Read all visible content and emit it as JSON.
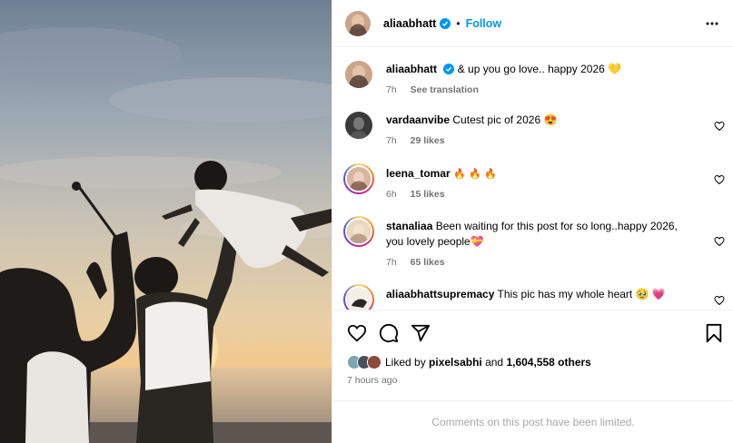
{
  "post_image": {
    "alt": ""
  },
  "header": {
    "username": "aliaabhatt",
    "separator": "•",
    "follow_label": "Follow",
    "more_icon": "more-horizontal-icon",
    "verified_color": "#0095f6"
  },
  "caption": {
    "username": "aliaabhatt",
    "text": "& up you go love.. happy 2026 💛",
    "time": "7h",
    "translate_label": "See translation"
  },
  "comments": [
    {
      "username": "vardaanvibe",
      "text": "Cutest pic of 2026 😍",
      "time": "7h",
      "likes": "29 likes"
    },
    {
      "username": "leena_tomar",
      "text": "🔥 🔥 🔥",
      "time": "6h",
      "likes": "15 likes"
    },
    {
      "username": "stanaliaa",
      "text": "Been waiting for this post for so long..happy 2026, you lovely people💝",
      "time": "7h",
      "likes": "65 likes"
    },
    {
      "username": "aliaabhattsupremacy",
      "text": "This pic has my whole heart 🥹 💗"
    }
  ],
  "actions": {
    "like_icon": "heart-icon",
    "comment_icon": "comment-icon",
    "share_icon": "share-icon",
    "save_icon": "bookmark-icon"
  },
  "likes": {
    "prefix": "Liked by",
    "user": "pixelsabhi",
    "and": "and",
    "count": "1,604,558 others"
  },
  "time_ago": "7 hours ago",
  "comments_limited": "Comments on this post have been limited.",
  "colors": {
    "accent": "#0095f6",
    "muted": "#737373",
    "border": "#efefef"
  }
}
